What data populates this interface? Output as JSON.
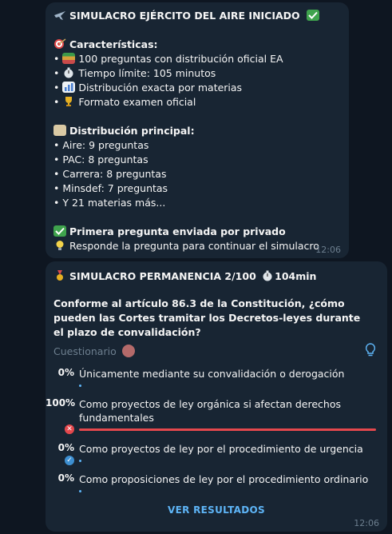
{
  "message1": {
    "title": "SIMULACRO EJÉRCITO DEL AIRE INICIADO",
    "features_heading": "Características:",
    "features": [
      "100 preguntas con distribución oficial EA",
      "Tiempo límite: 105 minutos",
      "Distribución exacta por materias",
      "Formato examen oficial"
    ],
    "distribution_heading": "Distribución principal:",
    "distribution": [
      "• Aire: 9 preguntas",
      "• PAC: 8 preguntas",
      "• Carrera: 8 preguntas",
      "• Minsdef: 7 preguntas",
      "• Y 21 materias más..."
    ],
    "sent_heading": "Primera pregunta enviada por privado",
    "sent_note": "Responde la pregunta para continuar el simulacro",
    "time": "12:06"
  },
  "message2": {
    "header": "SIMULACRO PERMANENCIA 2/100",
    "timer": "104min",
    "question": "Conforme al artículo 86.3 de la Constitución, ¿cómo pueden las Cortes tramitar los Decretos-leyes durante el plazo de convalidación?",
    "quiz_type": "Cuestionario",
    "options": [
      {
        "percent": "0%",
        "text": "Únicamente mediante su convalidación o derogación",
        "share": 0
      },
      {
        "percent": "100%",
        "text": "Como proyectos de ley orgánica si afectan derechos fundamentales",
        "share": 1,
        "status": "wrong"
      },
      {
        "percent": "0%",
        "text": "Como proyectos de ley por el procedimiento de urgencia",
        "share": 0,
        "status": "correct"
      },
      {
        "percent": "0%",
        "text": "Como proposiciones de ley por el procedimiento ordinario",
        "share": 0
      }
    ],
    "results_label": "VER RESULTADOS",
    "time": "12:06"
  },
  "colors": {
    "background": "#0e1621",
    "bubble": "#182533",
    "accent": "#5eb5f7",
    "wrong": "#e5484d",
    "correct": "#3d8fd1"
  },
  "icons": {
    "title": "airplane-icon",
    "title_check": "check-icon",
    "features": "target-icon",
    "feature_items": [
      "books-icon",
      "stopwatch-icon",
      "bar-chart-icon",
      "trophy-icon"
    ],
    "distribution": "clipboard-icon",
    "sent": "check-icon",
    "note": "lightbulb-icon",
    "msg2_header": "medal-icon",
    "msg2_timer": "stopwatch-icon",
    "hint": "lightbulb-icon"
  }
}
